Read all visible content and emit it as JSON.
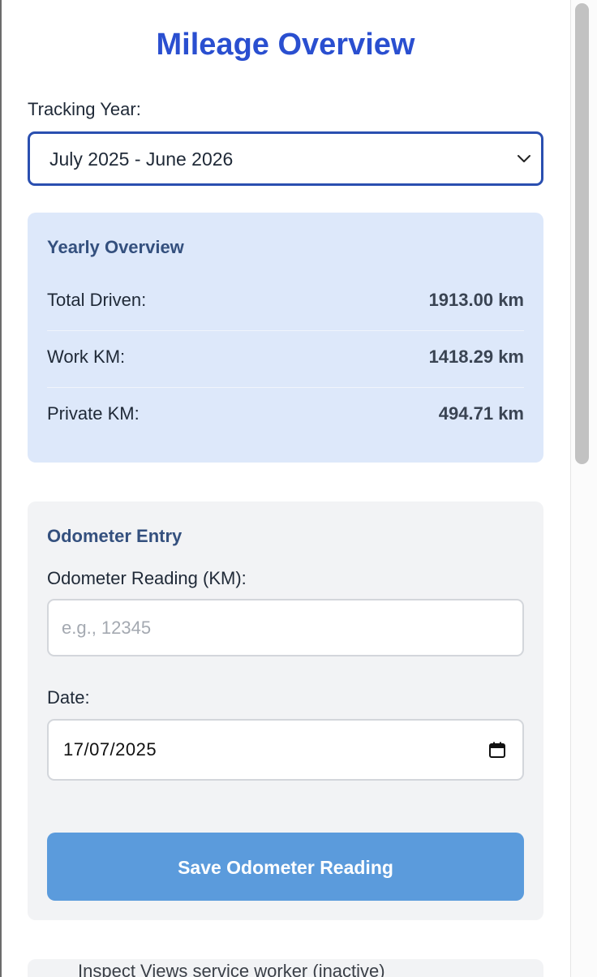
{
  "title": "Mileage Overview",
  "tracking_year": {
    "label": "Tracking Year:",
    "selected": "July 2025 - June 2026",
    "icon": "chevron-down-icon"
  },
  "yearly_overview": {
    "title": "Yearly Overview",
    "rows": [
      {
        "label": "Total Driven:",
        "value": "1913.00 km"
      },
      {
        "label": "Work KM:",
        "value": "1418.29 km"
      },
      {
        "label": "Private KM:",
        "value": "494.71 km"
      }
    ]
  },
  "odometer_entry": {
    "title": "Odometer Entry",
    "reading_label": "Odometer Reading (KM):",
    "reading_placeholder": "e.g., 12345",
    "reading_value": "",
    "date_label": "Date:",
    "date_value": "17/07/2025",
    "date_icon": "calendar-icon",
    "save_label": "Save Odometer Reading"
  },
  "next_section_peek": "Inspect Views service worker (inactive)",
  "colors": {
    "title": "#2a4fd0",
    "select_border": "#2a4fb0",
    "overview_bg": "#dde8fa",
    "card_title": "#34507e",
    "entry_bg": "#f2f3f5",
    "save_button": "#5b9bdc"
  }
}
